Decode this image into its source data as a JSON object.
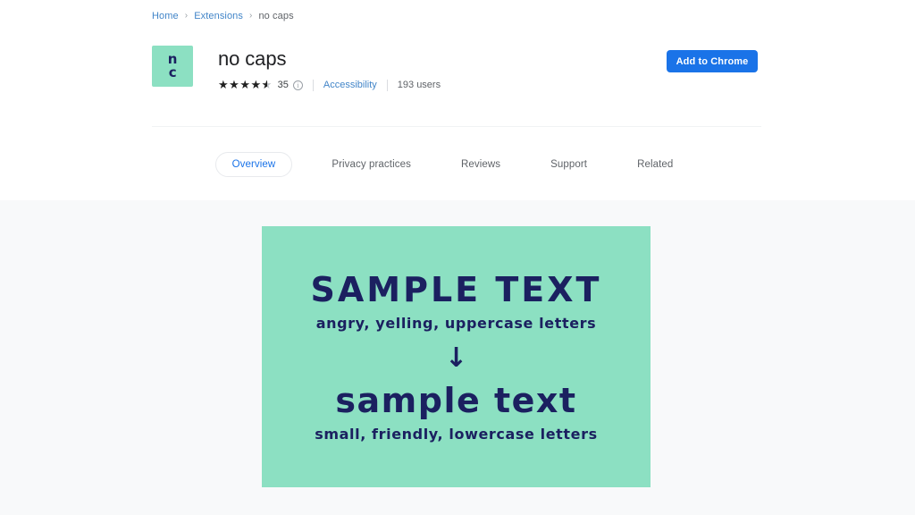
{
  "breadcrumb": {
    "items": [
      {
        "label": "Home",
        "type": "link"
      },
      {
        "label": "Extensions",
        "type": "link"
      },
      {
        "label": "no caps",
        "type": "current"
      }
    ],
    "separator": "›"
  },
  "extension": {
    "name": "no caps",
    "icon": {
      "line1": "n",
      "line2": "c",
      "background_color": "#8ce0c2",
      "text_color": "#1b2060"
    },
    "rating": {
      "value": 4.5,
      "stars_full": 4,
      "stars_half": 1,
      "star_glyph": "★",
      "review_count": "35",
      "info_glyph": "i"
    },
    "category": "Accessibility",
    "users": "193 users"
  },
  "actions": {
    "add_to_chrome": "Add to Chrome",
    "add_to_chrome_color": "#1a73e8"
  },
  "tabs": [
    {
      "label": "Overview",
      "active": true
    },
    {
      "label": "Privacy practices",
      "active": false
    },
    {
      "label": "Reviews",
      "active": false
    },
    {
      "label": "Support",
      "active": false
    },
    {
      "label": "Related",
      "active": false
    }
  ],
  "promo": {
    "background_color": "#8ce0c2",
    "text_color": "#1b2060",
    "headline_upper": "SAMPLE TEXT",
    "subtitle_upper": "angry, yelling, uppercase letters",
    "arrow_glyph": "↓",
    "headline_lower": "sample text",
    "subtitle_lower": "small, friendly, lowercase letters"
  }
}
